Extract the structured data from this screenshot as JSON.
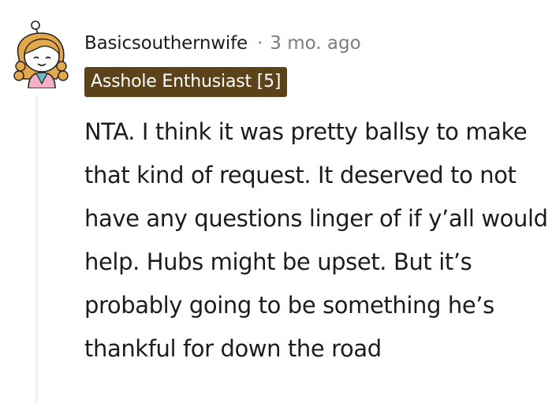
{
  "comment": {
    "author": "Basicsouthernwife",
    "separator": "·",
    "timestamp": "3 mo. ago",
    "flair": "Asshole Enthusiast [5]",
    "body": "NTA. I think it was pretty ballsy to make that kind of request. It deserved to not have any questions linger of if y’all would help. Hubs might be upset. But it’s probably going to be something he’s thankful for down the road",
    "avatar_icon": "snoo-avatar-icon",
    "colors": {
      "text": "#1c1c1c",
      "meta": "#7c7c7c",
      "flair_bg": "#5c4219",
      "flair_text": "#ffffff",
      "thread_line": "#edeff1"
    }
  }
}
